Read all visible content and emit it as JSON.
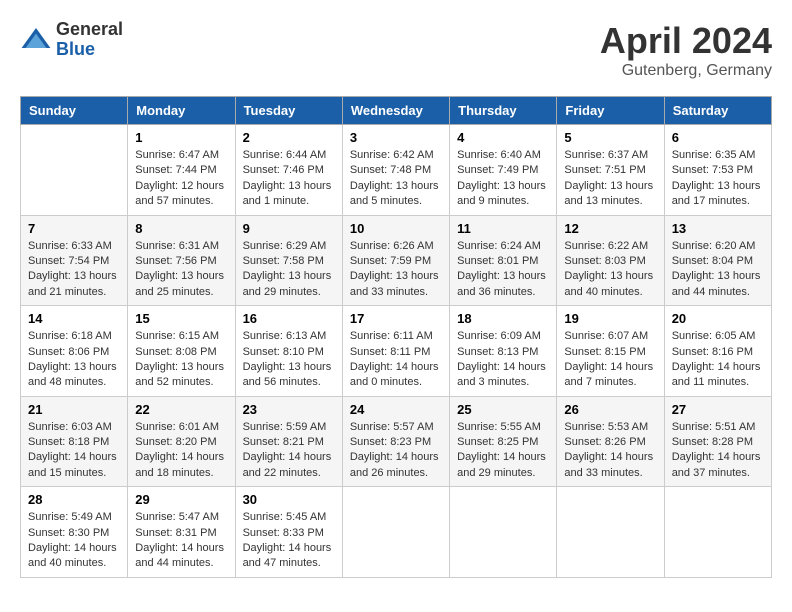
{
  "header": {
    "logo_general": "General",
    "logo_blue": "Blue",
    "month_year": "April 2024",
    "location": "Gutenberg, Germany"
  },
  "days_of_week": [
    "Sunday",
    "Monday",
    "Tuesday",
    "Wednesday",
    "Thursday",
    "Friday",
    "Saturday"
  ],
  "weeks": [
    [
      {
        "day": "",
        "sunrise": "",
        "sunset": "",
        "daylight": ""
      },
      {
        "day": "1",
        "sunrise": "Sunrise: 6:47 AM",
        "sunset": "Sunset: 7:44 PM",
        "daylight": "Daylight: 12 hours and 57 minutes."
      },
      {
        "day": "2",
        "sunrise": "Sunrise: 6:44 AM",
        "sunset": "Sunset: 7:46 PM",
        "daylight": "Daylight: 13 hours and 1 minute."
      },
      {
        "day": "3",
        "sunrise": "Sunrise: 6:42 AM",
        "sunset": "Sunset: 7:48 PM",
        "daylight": "Daylight: 13 hours and 5 minutes."
      },
      {
        "day": "4",
        "sunrise": "Sunrise: 6:40 AM",
        "sunset": "Sunset: 7:49 PM",
        "daylight": "Daylight: 13 hours and 9 minutes."
      },
      {
        "day": "5",
        "sunrise": "Sunrise: 6:37 AM",
        "sunset": "Sunset: 7:51 PM",
        "daylight": "Daylight: 13 hours and 13 minutes."
      },
      {
        "day": "6",
        "sunrise": "Sunrise: 6:35 AM",
        "sunset": "Sunset: 7:53 PM",
        "daylight": "Daylight: 13 hours and 17 minutes."
      }
    ],
    [
      {
        "day": "7",
        "sunrise": "Sunrise: 6:33 AM",
        "sunset": "Sunset: 7:54 PM",
        "daylight": "Daylight: 13 hours and 21 minutes."
      },
      {
        "day": "8",
        "sunrise": "Sunrise: 6:31 AM",
        "sunset": "Sunset: 7:56 PM",
        "daylight": "Daylight: 13 hours and 25 minutes."
      },
      {
        "day": "9",
        "sunrise": "Sunrise: 6:29 AM",
        "sunset": "Sunset: 7:58 PM",
        "daylight": "Daylight: 13 hours and 29 minutes."
      },
      {
        "day": "10",
        "sunrise": "Sunrise: 6:26 AM",
        "sunset": "Sunset: 7:59 PM",
        "daylight": "Daylight: 13 hours and 33 minutes."
      },
      {
        "day": "11",
        "sunrise": "Sunrise: 6:24 AM",
        "sunset": "Sunset: 8:01 PM",
        "daylight": "Daylight: 13 hours and 36 minutes."
      },
      {
        "day": "12",
        "sunrise": "Sunrise: 6:22 AM",
        "sunset": "Sunset: 8:03 PM",
        "daylight": "Daylight: 13 hours and 40 minutes."
      },
      {
        "day": "13",
        "sunrise": "Sunrise: 6:20 AM",
        "sunset": "Sunset: 8:04 PM",
        "daylight": "Daylight: 13 hours and 44 minutes."
      }
    ],
    [
      {
        "day": "14",
        "sunrise": "Sunrise: 6:18 AM",
        "sunset": "Sunset: 8:06 PM",
        "daylight": "Daylight: 13 hours and 48 minutes."
      },
      {
        "day": "15",
        "sunrise": "Sunrise: 6:15 AM",
        "sunset": "Sunset: 8:08 PM",
        "daylight": "Daylight: 13 hours and 52 minutes."
      },
      {
        "day": "16",
        "sunrise": "Sunrise: 6:13 AM",
        "sunset": "Sunset: 8:10 PM",
        "daylight": "Daylight: 13 hours and 56 minutes."
      },
      {
        "day": "17",
        "sunrise": "Sunrise: 6:11 AM",
        "sunset": "Sunset: 8:11 PM",
        "daylight": "Daylight: 14 hours and 0 minutes."
      },
      {
        "day": "18",
        "sunrise": "Sunrise: 6:09 AM",
        "sunset": "Sunset: 8:13 PM",
        "daylight": "Daylight: 14 hours and 3 minutes."
      },
      {
        "day": "19",
        "sunrise": "Sunrise: 6:07 AM",
        "sunset": "Sunset: 8:15 PM",
        "daylight": "Daylight: 14 hours and 7 minutes."
      },
      {
        "day": "20",
        "sunrise": "Sunrise: 6:05 AM",
        "sunset": "Sunset: 8:16 PM",
        "daylight": "Daylight: 14 hours and 11 minutes."
      }
    ],
    [
      {
        "day": "21",
        "sunrise": "Sunrise: 6:03 AM",
        "sunset": "Sunset: 8:18 PM",
        "daylight": "Daylight: 14 hours and 15 minutes."
      },
      {
        "day": "22",
        "sunrise": "Sunrise: 6:01 AM",
        "sunset": "Sunset: 8:20 PM",
        "daylight": "Daylight: 14 hours and 18 minutes."
      },
      {
        "day": "23",
        "sunrise": "Sunrise: 5:59 AM",
        "sunset": "Sunset: 8:21 PM",
        "daylight": "Daylight: 14 hours and 22 minutes."
      },
      {
        "day": "24",
        "sunrise": "Sunrise: 5:57 AM",
        "sunset": "Sunset: 8:23 PM",
        "daylight": "Daylight: 14 hours and 26 minutes."
      },
      {
        "day": "25",
        "sunrise": "Sunrise: 5:55 AM",
        "sunset": "Sunset: 8:25 PM",
        "daylight": "Daylight: 14 hours and 29 minutes."
      },
      {
        "day": "26",
        "sunrise": "Sunrise: 5:53 AM",
        "sunset": "Sunset: 8:26 PM",
        "daylight": "Daylight: 14 hours and 33 minutes."
      },
      {
        "day": "27",
        "sunrise": "Sunrise: 5:51 AM",
        "sunset": "Sunset: 8:28 PM",
        "daylight": "Daylight: 14 hours and 37 minutes."
      }
    ],
    [
      {
        "day": "28",
        "sunrise": "Sunrise: 5:49 AM",
        "sunset": "Sunset: 8:30 PM",
        "daylight": "Daylight: 14 hours and 40 minutes."
      },
      {
        "day": "29",
        "sunrise": "Sunrise: 5:47 AM",
        "sunset": "Sunset: 8:31 PM",
        "daylight": "Daylight: 14 hours and 44 minutes."
      },
      {
        "day": "30",
        "sunrise": "Sunrise: 5:45 AM",
        "sunset": "Sunset: 8:33 PM",
        "daylight": "Daylight: 14 hours and 47 minutes."
      },
      {
        "day": "",
        "sunrise": "",
        "sunset": "",
        "daylight": ""
      },
      {
        "day": "",
        "sunrise": "",
        "sunset": "",
        "daylight": ""
      },
      {
        "day": "",
        "sunrise": "",
        "sunset": "",
        "daylight": ""
      },
      {
        "day": "",
        "sunrise": "",
        "sunset": "",
        "daylight": ""
      }
    ]
  ]
}
